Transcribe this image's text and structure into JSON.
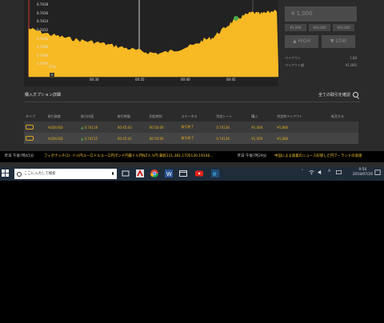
{
  "chart": {
    "y_labels": [
      "0.7418",
      "0.7416",
      "0.7414",
      "0.7412",
      "0.7410",
      "0.7408",
      "0.7406",
      "0.7404"
    ],
    "x_labels": [
      "00:30",
      "00:35",
      "00:40",
      "00:45"
    ],
    "pct_label": "51%",
    "zoom_label": "+",
    "series_color": "#f7b924"
  },
  "panel": {
    "amount": "¥ 1,000",
    "quick_amounts": [
      "¥5,000",
      "¥10,000",
      "¥50,000"
    ],
    "high_label": "▲ HIGH",
    "low_label": "▼ LOW",
    "payout_rate_label": "ペイアウト",
    "payout_rate_value": "1.88",
    "payout_amount_label": "ペイアウト額",
    "payout_amount_value": "¥1,880"
  },
  "history": {
    "title": "購入オプション詳細",
    "link": "全ての取引を確認",
    "columns": [
      "タイプ",
      "取引資産",
      "取引内容",
      "取引時間",
      "判定時刻",
      "ステータス",
      "判定レート",
      "購入",
      "判定時ペイアウト",
      "転売する"
    ],
    "rows": [
      {
        "asset": "AUD/USD",
        "entry": "0.74118",
        "time": "00:45:43",
        "expiry": "00:50:00",
        "status": "取引終了",
        "rate": "0.74136",
        "buy": "¥1,000",
        "payout": "¥1,880",
        "resale": ""
      },
      {
        "asset": "AUD/USD",
        "entry": "0.74115",
        "time": "00:45:41",
        "expiry": "00:50:00",
        "status": "取引終了",
        "rate": "0.74136",
        "buy": "¥1,000",
        "payout": "¥1,880",
        "resale": ""
      }
    ]
  },
  "ticker": {
    "time1": "昨日 午後7時41分",
    "text1": "フィボナッチ(1): ドル円ユーロドルユーロ円ポンド円豪ドル円NZドル円 豪銘111.381.1705130.19146...",
    "time2": "昨日 午後7時29分",
    "text2": "中国による殺義のニュース好感した円ア・ランドの底値"
  },
  "taskbar": {
    "search_placeholder": "ここに入力して検索",
    "clock_time": "0:50",
    "clock_date": "2018/07/26",
    "ime": "A"
  }
}
